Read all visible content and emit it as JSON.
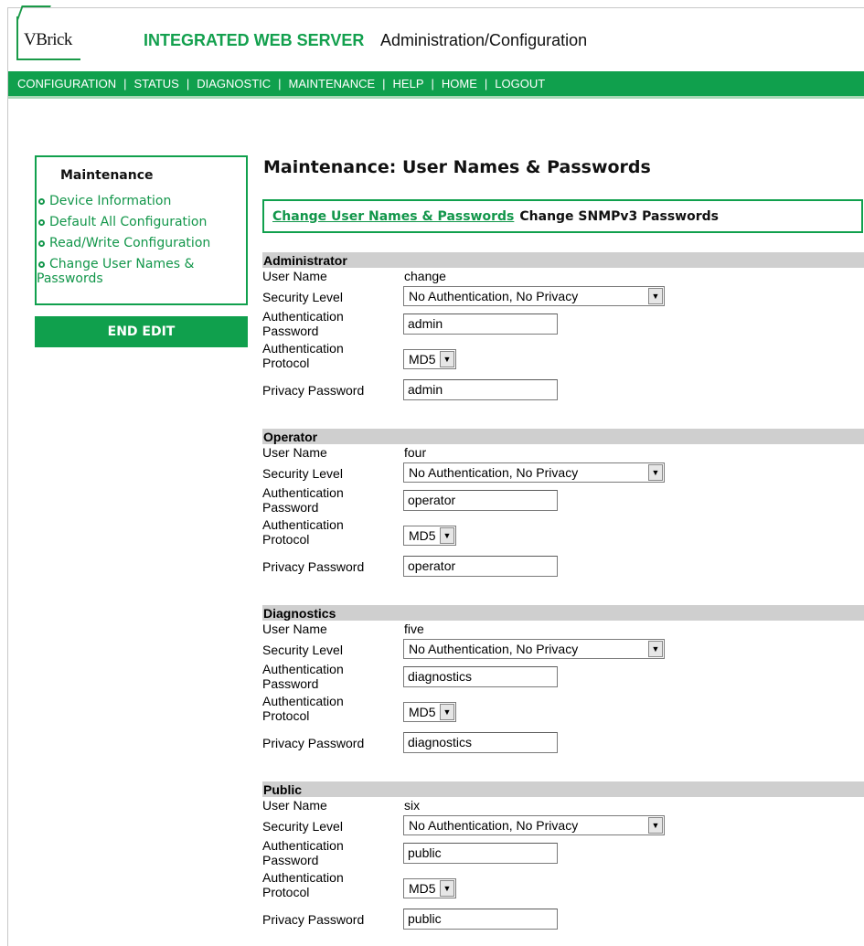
{
  "header": {
    "logo": "VBrick",
    "title": "INTEGRATED WEB SERVER",
    "subtitle": "Administration/Configuration"
  },
  "nav": [
    "CONFIGURATION",
    "STATUS",
    "DIAGNOSTIC",
    "MAINTENANCE",
    "HELP",
    "HOME",
    "LOGOUT"
  ],
  "sidebar": {
    "title": "Maintenance",
    "items": [
      {
        "label": "Device Information"
      },
      {
        "label": "Default All Configuration"
      },
      {
        "label": "Read/Write Configuration"
      },
      {
        "label": "Change User Names & Passwords"
      }
    ],
    "end_edit": "END EDIT"
  },
  "page": {
    "title": "Maintenance: User Names & Passwords",
    "tabs": {
      "active": "Change User Names & Passwords",
      "other": "Change SNMPv3 Passwords"
    }
  },
  "labels": {
    "user_name": "User Name",
    "security_level": "Security Level",
    "auth_password_1": "Authentication",
    "auth_password_2": "Password",
    "auth_protocol_1": "Authentication",
    "auth_protocol_2": "Protocol",
    "privacy_password": "Privacy Password"
  },
  "sections": [
    {
      "name": "Administrator",
      "user_name": "change",
      "security_level": "No Authentication, No Privacy",
      "auth_password": "admin",
      "auth_protocol": "MD5",
      "privacy_password": "admin"
    },
    {
      "name": "Operator",
      "user_name": "four",
      "security_level": "No Authentication, No Privacy",
      "auth_password": "operator",
      "auth_protocol": "MD5",
      "privacy_password": "operator"
    },
    {
      "name": "Diagnostics",
      "user_name": "five",
      "security_level": "No Authentication, No Privacy",
      "auth_password": "diagnostics",
      "auth_protocol": "MD5",
      "privacy_password": "diagnostics"
    },
    {
      "name": "Public",
      "user_name": "six",
      "security_level": "No Authentication, No Privacy",
      "auth_password": "public",
      "auth_protocol": "MD5",
      "privacy_password": "public"
    }
  ],
  "colors": {
    "brand_green": "#10a04d",
    "section_gray": "#cfcfcf"
  }
}
